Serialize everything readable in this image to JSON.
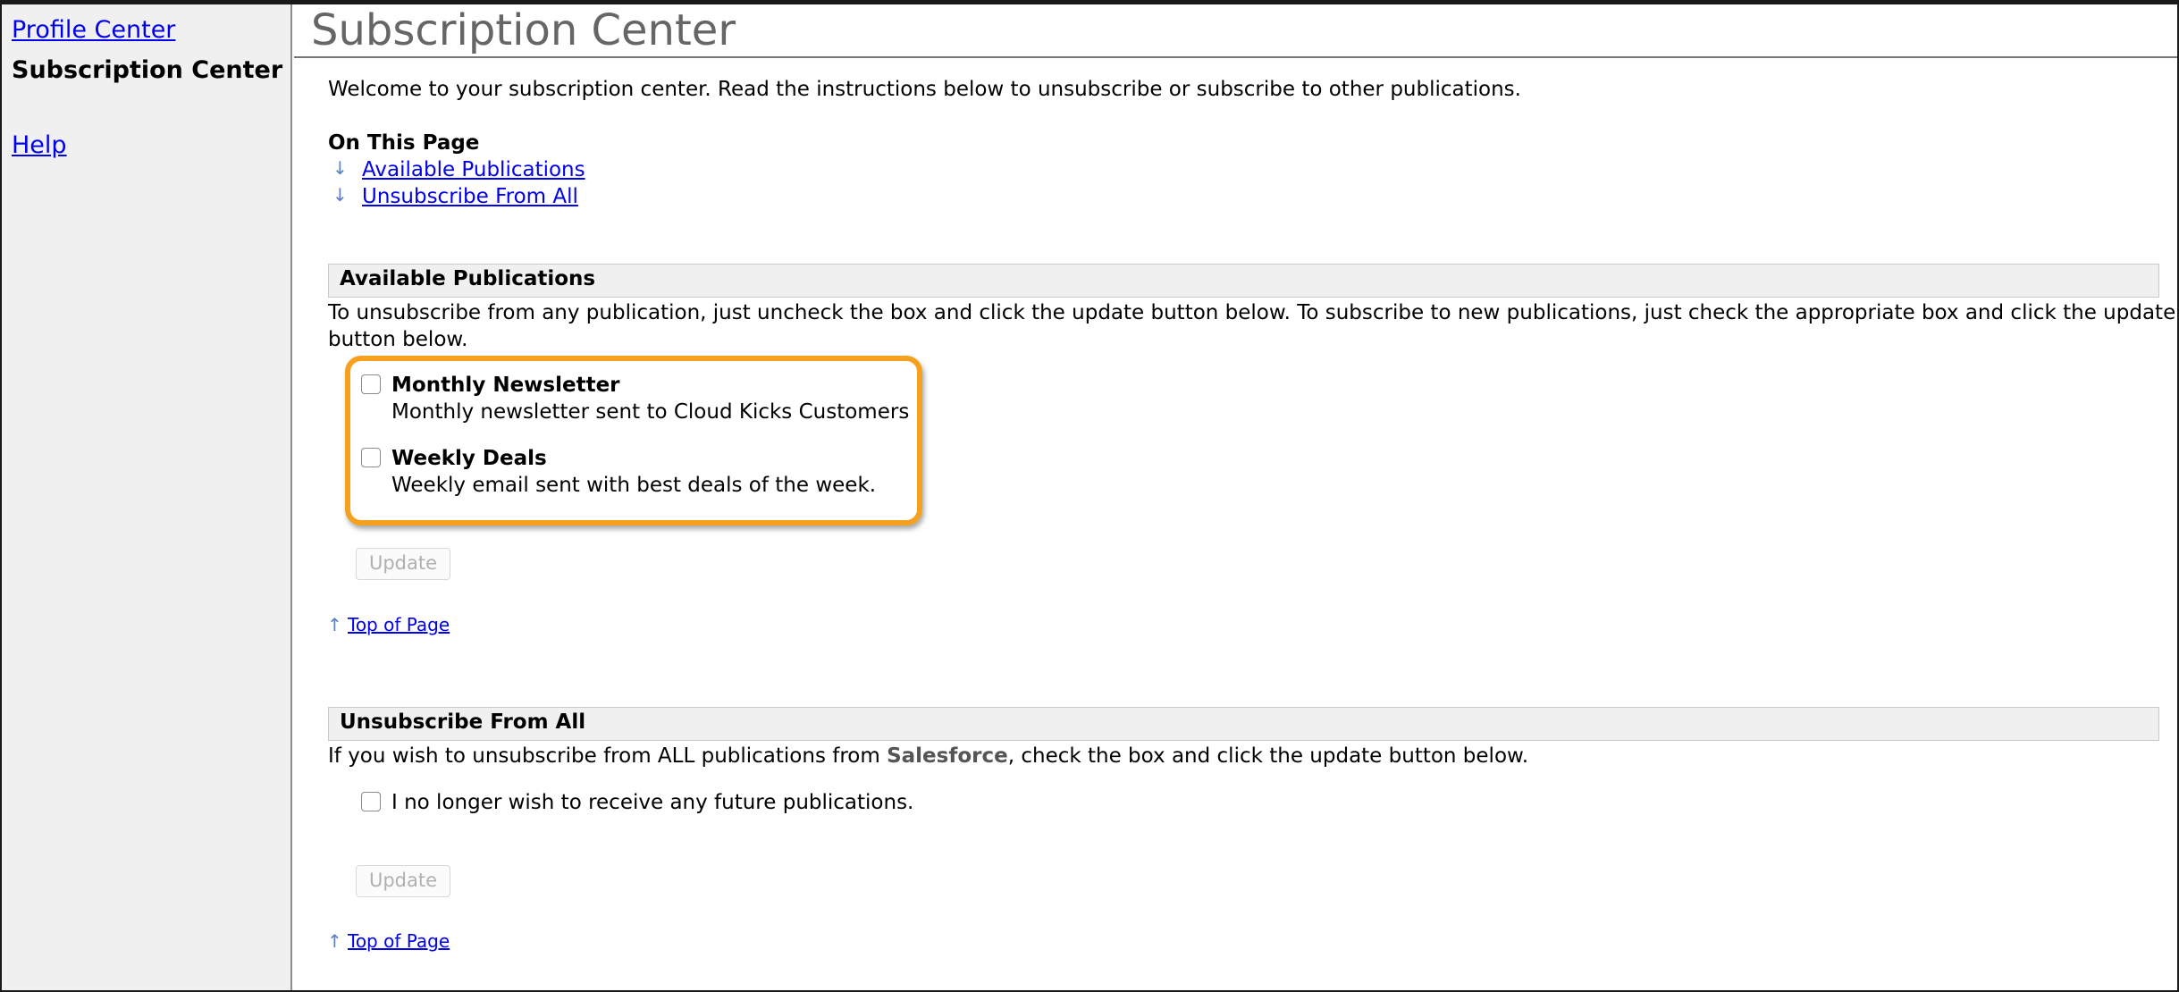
{
  "sidebar": {
    "items": [
      {
        "label": "Profile Center"
      },
      {
        "label": "Subscription Center"
      },
      {
        "label": "Help"
      }
    ]
  },
  "main": {
    "title": "Subscription Center",
    "welcome": "Welcome to your subscription center. Read the instructions below to unsubscribe or subscribe to other publications.",
    "on_this_page": {
      "heading": "On This Page",
      "links": [
        {
          "label": "Available Publications"
        },
        {
          "label": "Unsubscribe From All"
        }
      ]
    },
    "available": {
      "heading": "Available Publications",
      "instructions_line1": "To unsubscribe from any publication, just uncheck the box and click the update button below. To subscribe to new publications, just check the appropriate box and click the update",
      "instructions_line2": "button below.",
      "publications": [
        {
          "name": "Monthly Newsletter",
          "description": "Monthly newsletter sent to Cloud Kicks Customers",
          "checked": false
        },
        {
          "name": "Weekly Deals",
          "description": "Weekly email sent with best deals of the week.",
          "checked": false
        }
      ],
      "update_label": "Update",
      "top_link": "Top of Page"
    },
    "unsubscribe_all": {
      "heading": "Unsubscribe From All",
      "text_before": "If you wish to unsubscribe from ALL publications from ",
      "brand": "Salesforce",
      "text_after": ", check the box and click the update button below.",
      "checkbox_label": "I no longer wish to receive any future publications.",
      "checked": false,
      "update_label": "Update",
      "top_link": "Top of Page"
    }
  },
  "icons": {
    "down_arrow": "↓",
    "up_arrow": "↑"
  },
  "colors": {
    "highlight": "#f5a01f",
    "link": "#0000ee",
    "sidebar_bg": "#f0f0f0",
    "title": "#666666"
  }
}
